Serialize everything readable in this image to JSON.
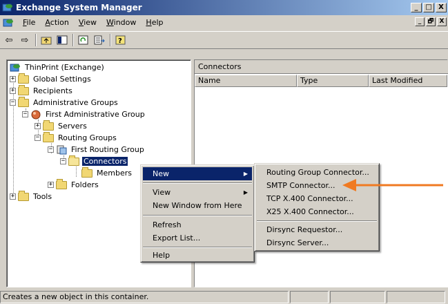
{
  "window": {
    "title": "Exchange System Manager",
    "controls": [
      "_",
      "□",
      "X"
    ],
    "mdi_controls": [
      "_",
      "🗗",
      "X"
    ]
  },
  "menubar": {
    "items": [
      "File",
      "Action",
      "View",
      "Window",
      "Help"
    ]
  },
  "toolbar": {
    "buttons": [
      "back-icon",
      "forward-icon",
      "up-folder-icon",
      "show-hide-tree-icon",
      "refresh-icon",
      "export-list-icon",
      "help-icon"
    ]
  },
  "tree": {
    "items": [
      {
        "label": "ThinPrint (Exchange)",
        "icon": "server-icon"
      },
      {
        "label": "Global Settings",
        "icon": "folder-icon"
      },
      {
        "label": "Recipients",
        "icon": "folder-icon"
      },
      {
        "label": "Administrative Groups",
        "icon": "folder-icon"
      },
      {
        "label": "First Administrative Group",
        "icon": "admin-group-icon"
      },
      {
        "label": "Servers",
        "icon": "folder-icon"
      },
      {
        "label": "Routing Groups",
        "icon": "folder-icon"
      },
      {
        "label": "First Routing Group",
        "icon": "routing-group-icon"
      },
      {
        "label": "Connectors",
        "icon": "folder-open-icon"
      },
      {
        "label": "Members",
        "icon": "folder-icon"
      },
      {
        "label": "Folders",
        "icon": "folder-icon"
      },
      {
        "label": "Tools",
        "icon": "folder-icon"
      }
    ]
  },
  "right_pane": {
    "title": "Connectors",
    "columns": [
      "Name",
      "Type",
      "Last Modified"
    ]
  },
  "context_menu": {
    "items": [
      "New",
      "View",
      "New Window from Here",
      "Refresh",
      "Export List...",
      "Help"
    ]
  },
  "submenu": {
    "items": [
      "Routing Group Connector...",
      "SMTP Connector...",
      "TCP X.400 Connector...",
      "X25 X.400 Connector...",
      "Dirsync Requestor...",
      "Dirsync Server..."
    ]
  },
  "statusbar": {
    "text": "Creates a new object in this container."
  },
  "colors": {
    "selection": "#0a246a",
    "annotation_arrow": "#f07a22",
    "folder": "#f1d773"
  }
}
